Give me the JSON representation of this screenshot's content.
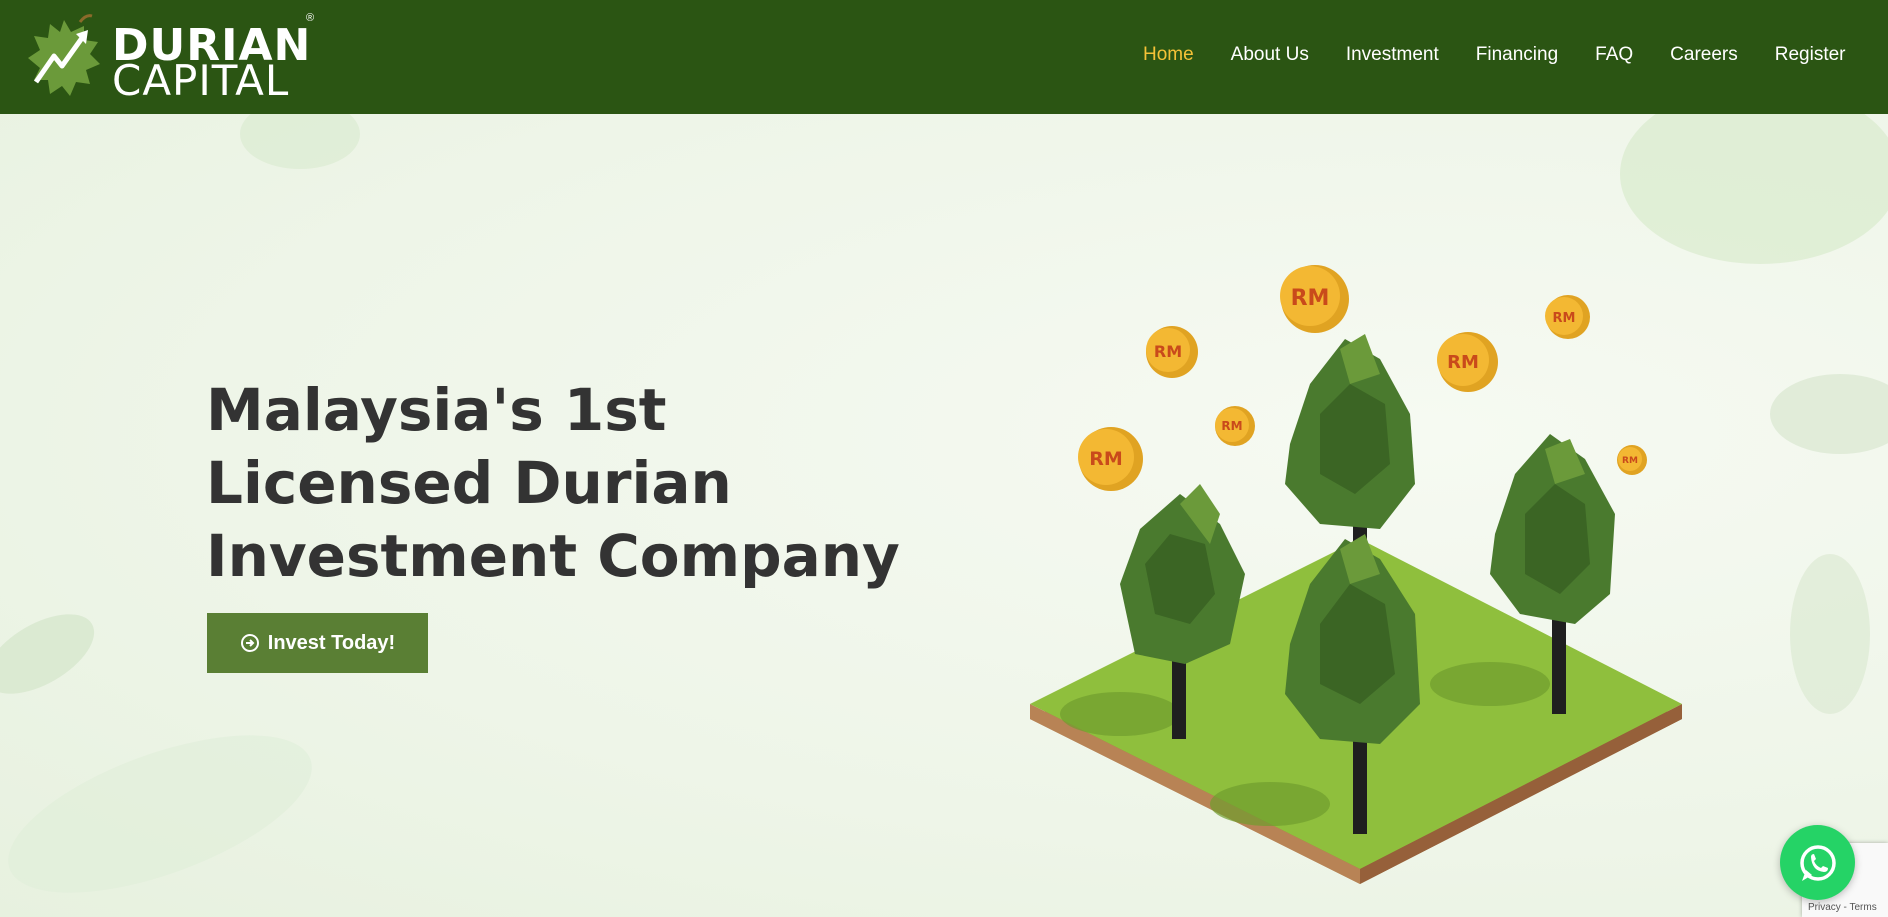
{
  "logo": {
    "line1": "DURIAN",
    "line2": "CAPITAL",
    "reg": "®"
  },
  "nav": {
    "items": [
      "Home",
      "About Us",
      "Investment",
      "Financing",
      "FAQ",
      "Careers",
      "Register"
    ],
    "active": "Home"
  },
  "hero": {
    "headline_1": "Malaysia's 1st",
    "headline_2": "Licensed Durian",
    "headline_3": "Investment Company",
    "cta_label": "Invest Today!"
  },
  "illustration": {
    "coin_label": "RM"
  },
  "widgets": {
    "whatsapp_icon": "whatsapp-icon",
    "recaptcha_text": "Privacy - Terms"
  },
  "colors": {
    "header_bg": "#2b5513",
    "nav_active": "#f4c237",
    "cta_bg": "#5a7f34",
    "headline": "#333333"
  }
}
